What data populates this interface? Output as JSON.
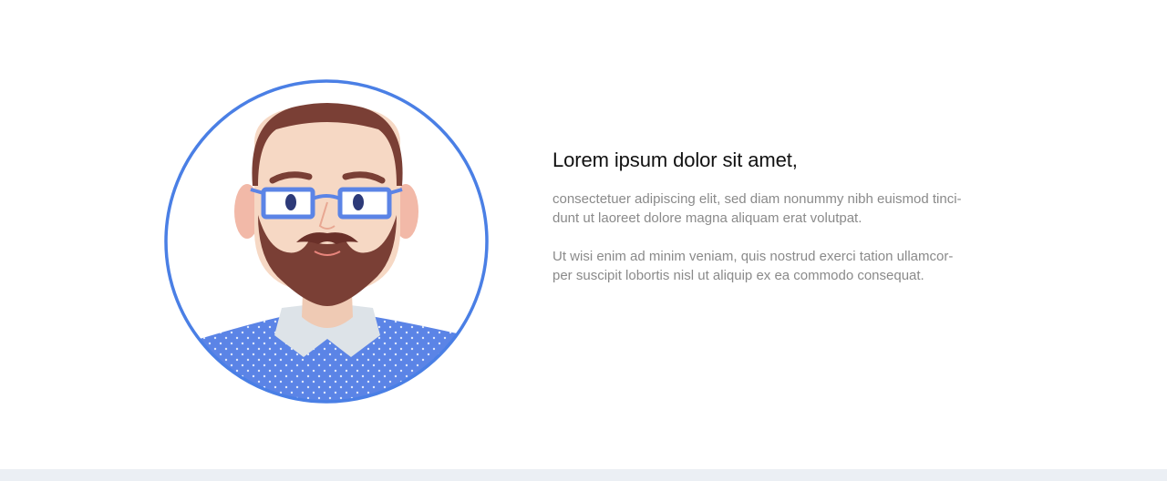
{
  "content": {
    "heading": "Lorem ipsum dolor sit amet,",
    "paragraph_1": "consectetuer adipiscing elit, sed diam nonummy nibh euismod tinci-\ndunt ut laoreet dolore magna aliquam erat volutpat.",
    "paragraph_2": "Ut wisi enim ad minim veniam, quis nostrud exerci tation ullamcor-\nper suscipit lobortis nisl ut aliquip ex ea commodo consequat."
  },
  "avatar": {
    "icon": "man-with-glasses-portrait",
    "ring_color": "#4a7fe5",
    "shirt_color": "#5b84e6",
    "glasses_color": "#5b84e6",
    "hair_color": "#7a3f35",
    "skin_color": "#f5d8c4"
  },
  "colors": {
    "heading": "#111111",
    "body_text": "#8a8a8a",
    "bottom_band": "#ebeff4"
  }
}
